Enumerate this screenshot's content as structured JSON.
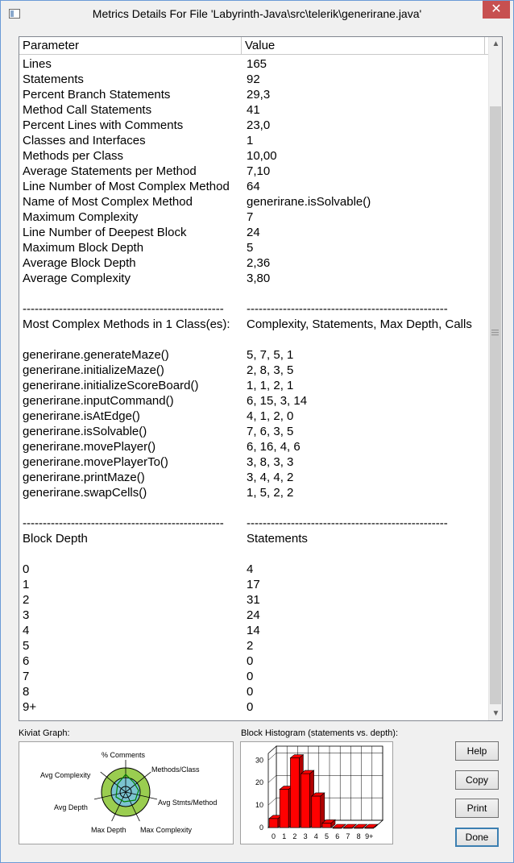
{
  "window": {
    "title": "Metrics Details For File 'Labyrinth-Java\\src\\telerik\\generirane.java'",
    "close_label": "✕"
  },
  "table": {
    "headers": {
      "parameter": "Parameter",
      "value": "Value"
    },
    "rows": [
      [
        "Lines",
        "165"
      ],
      [
        "Statements",
        "92"
      ],
      [
        "Percent Branch Statements",
        "29,3"
      ],
      [
        "Method Call Statements",
        "41"
      ],
      [
        "Percent Lines with Comments",
        "23,0"
      ],
      [
        "Classes and Interfaces",
        "1"
      ],
      [
        "Methods per Class",
        "10,00"
      ],
      [
        "Average Statements per Method",
        "7,10"
      ],
      [
        "Line Number of Most Complex Method",
        "64"
      ],
      [
        "Name of Most Complex Method",
        "generirane.isSolvable()"
      ],
      [
        "Maximum Complexity",
        "7"
      ],
      [
        "Line Number of Deepest Block",
        "24"
      ],
      [
        "Maximum Block Depth",
        "5"
      ],
      [
        "Average Block Depth",
        "2,36"
      ],
      [
        "Average Complexity",
        "3,80"
      ],
      [
        "",
        ""
      ],
      [
        "--------------------------------------------------",
        "--------------------------------------------------"
      ],
      [
        "Most Complex Methods in 1 Class(es):",
        "Complexity, Statements, Max Depth, Calls"
      ],
      [
        "",
        ""
      ],
      [
        "generirane.generateMaze()",
        "5, 7, 5, 1"
      ],
      [
        "generirane.initializeMaze()",
        "2, 8, 3, 5"
      ],
      [
        "generirane.initializeScoreBoard()",
        "1, 1, 2, 1"
      ],
      [
        "generirane.inputCommand()",
        "6, 15, 3, 14"
      ],
      [
        "generirane.isAtEdge()",
        "4, 1, 2, 0"
      ],
      [
        "generirane.isSolvable()",
        "7, 6, 3, 5"
      ],
      [
        "generirane.movePlayer()",
        "6, 16, 4, 6"
      ],
      [
        "generirane.movePlayerTo()",
        "3, 8, 3, 3"
      ],
      [
        "generirane.printMaze()",
        "3, 4, 4, 2"
      ],
      [
        "generirane.swapCells()",
        "1, 5, 2, 2"
      ],
      [
        "",
        ""
      ],
      [
        "--------------------------------------------------",
        "--------------------------------------------------"
      ],
      [
        "Block Depth",
        "Statements"
      ],
      [
        "",
        ""
      ],
      [
        "0",
        "4"
      ],
      [
        "1",
        "17"
      ],
      [
        "2",
        "31"
      ],
      [
        "3",
        "24"
      ],
      [
        "4",
        "14"
      ],
      [
        "5",
        "2"
      ],
      [
        "6",
        "0"
      ],
      [
        "7",
        "0"
      ],
      [
        "8",
        "0"
      ],
      [
        "9+",
        "0"
      ]
    ]
  },
  "kiviat": {
    "label": "Kiviat Graph:",
    "axes": [
      "% Comments",
      "Methods/Class",
      "Avg Stmts/Method",
      "Max Complexity",
      "Max Depth",
      "Avg Depth",
      "Avg Complexity"
    ]
  },
  "histogram": {
    "label": "Block Histogram (statements vs. depth):"
  },
  "buttons": {
    "help": "Help",
    "copy": "Copy",
    "print": "Print",
    "done": "Done"
  },
  "chart_data": {
    "type": "bar",
    "categories": [
      "0",
      "1",
      "2",
      "3",
      "4",
      "5",
      "6",
      "7",
      "8",
      "9+"
    ],
    "values": [
      4,
      17,
      31,
      24,
      14,
      2,
      0,
      0,
      0,
      0
    ],
    "y_ticks": [
      "0",
      "10",
      "20",
      "30"
    ],
    "ylim": [
      0,
      33
    ],
    "bar_color": "#ff0000",
    "grid": true
  }
}
